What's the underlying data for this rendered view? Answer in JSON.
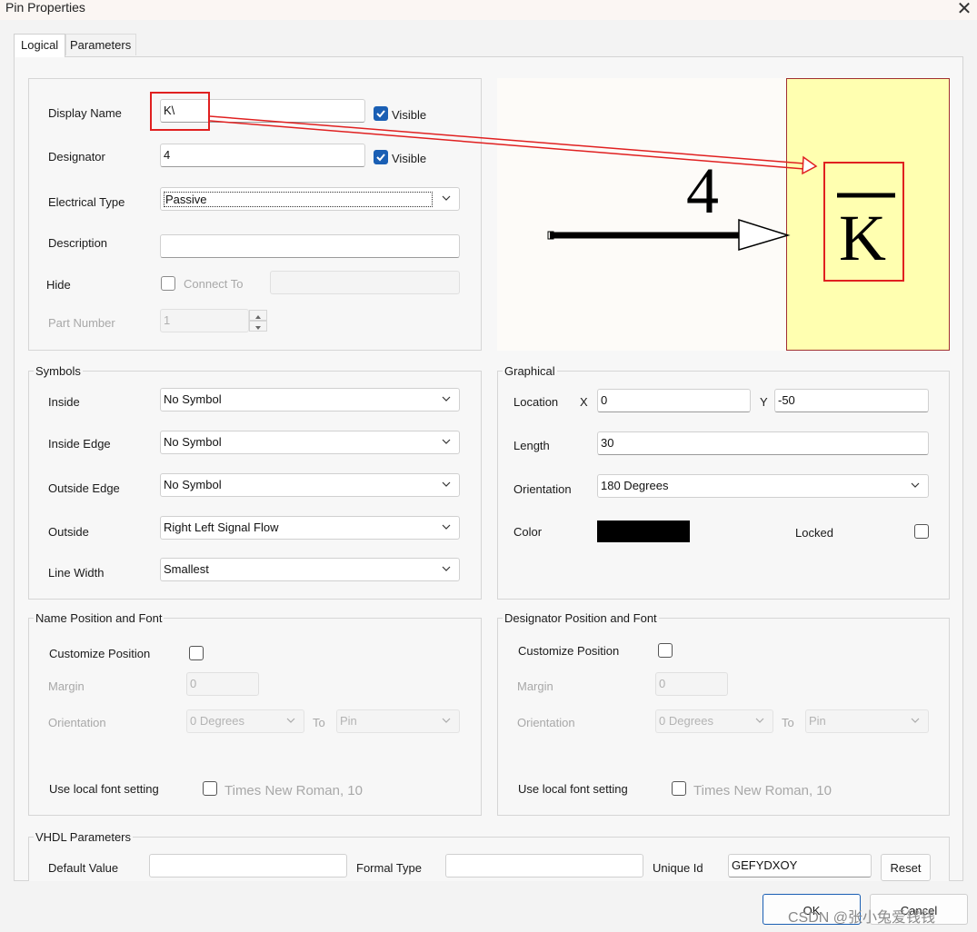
{
  "window": {
    "title": "Pin Properties",
    "close_glyph": "✕"
  },
  "tabs": [
    {
      "label": "Logical"
    },
    {
      "label": "Parameters"
    }
  ],
  "logical": {
    "display_name": {
      "label": "Display Name",
      "value": "K\\",
      "visible_label": "Visible",
      "visible": true
    },
    "designator": {
      "label": "Designator",
      "value": "4",
      "visible_label": "Visible",
      "visible": true
    },
    "electrical_type": {
      "label": "Electrical Type",
      "value": "Passive"
    },
    "description": {
      "label": "Description",
      "value": ""
    },
    "hide": {
      "label": "Hide",
      "connect_to_label": "Connect To",
      "checked": false,
      "connect_to_value": ""
    },
    "part_number": {
      "label": "Part Number",
      "value": "1"
    }
  },
  "preview": {
    "designator_text": "4",
    "name_text": "K",
    "pin_color": "#000000",
    "body_color": "#ffffb0",
    "body_border": "#c02020",
    "annotation_color": "#e02020"
  },
  "symbols": {
    "title": "Symbols",
    "inside": {
      "label": "Inside",
      "value": "No Symbol"
    },
    "inside_edge": {
      "label": "Inside Edge",
      "value": "No Symbol"
    },
    "outside_edge": {
      "label": "Outside Edge",
      "value": "No Symbol"
    },
    "outside": {
      "label": "Outside",
      "value": "Right Left Signal Flow"
    },
    "line_width": {
      "label": "Line Width",
      "value": "Smallest"
    }
  },
  "graphical": {
    "title": "Graphical",
    "location": {
      "label": "Location",
      "x_label": "X",
      "x": "0",
      "y_label": "Y",
      "y": "-50"
    },
    "length": {
      "label": "Length",
      "value": "30"
    },
    "orientation": {
      "label": "Orientation",
      "value": "180 Degrees"
    },
    "color": {
      "label": "Color",
      "value": "#000000"
    },
    "locked": {
      "label": "Locked",
      "checked": false
    }
  },
  "name_font": {
    "title": "Name Position and Font",
    "customize_label": "Customize Position",
    "margin_label": "Margin",
    "margin": "0",
    "orientation_label": "Orientation",
    "orientation": "0 Degrees",
    "to_label": "To",
    "to": "Pin",
    "local_font_label": "Use local font setting",
    "font": "Times New Roman, 10"
  },
  "designator_font": {
    "title": "Designator Position and Font",
    "customize_label": "Customize Position",
    "margin_label": "Margin",
    "margin": "0",
    "orientation_label": "Orientation",
    "orientation": "0 Degrees",
    "to_label": "To",
    "to": "Pin",
    "local_font_label": "Use local font setting",
    "font": "Times New Roman, 10"
  },
  "vhdl": {
    "title": "VHDL Parameters",
    "default_value_label": "Default Value",
    "default_value": "",
    "formal_type_label": "Formal Type",
    "formal_type": "",
    "unique_id_label": "Unique Id",
    "unique_id": "GEFYDXOY",
    "reset_label": "Reset"
  },
  "footer": {
    "ok_label": "OK",
    "cancel_label": "Cancel"
  },
  "watermark": "CSDN @张小兔爱钱钱"
}
